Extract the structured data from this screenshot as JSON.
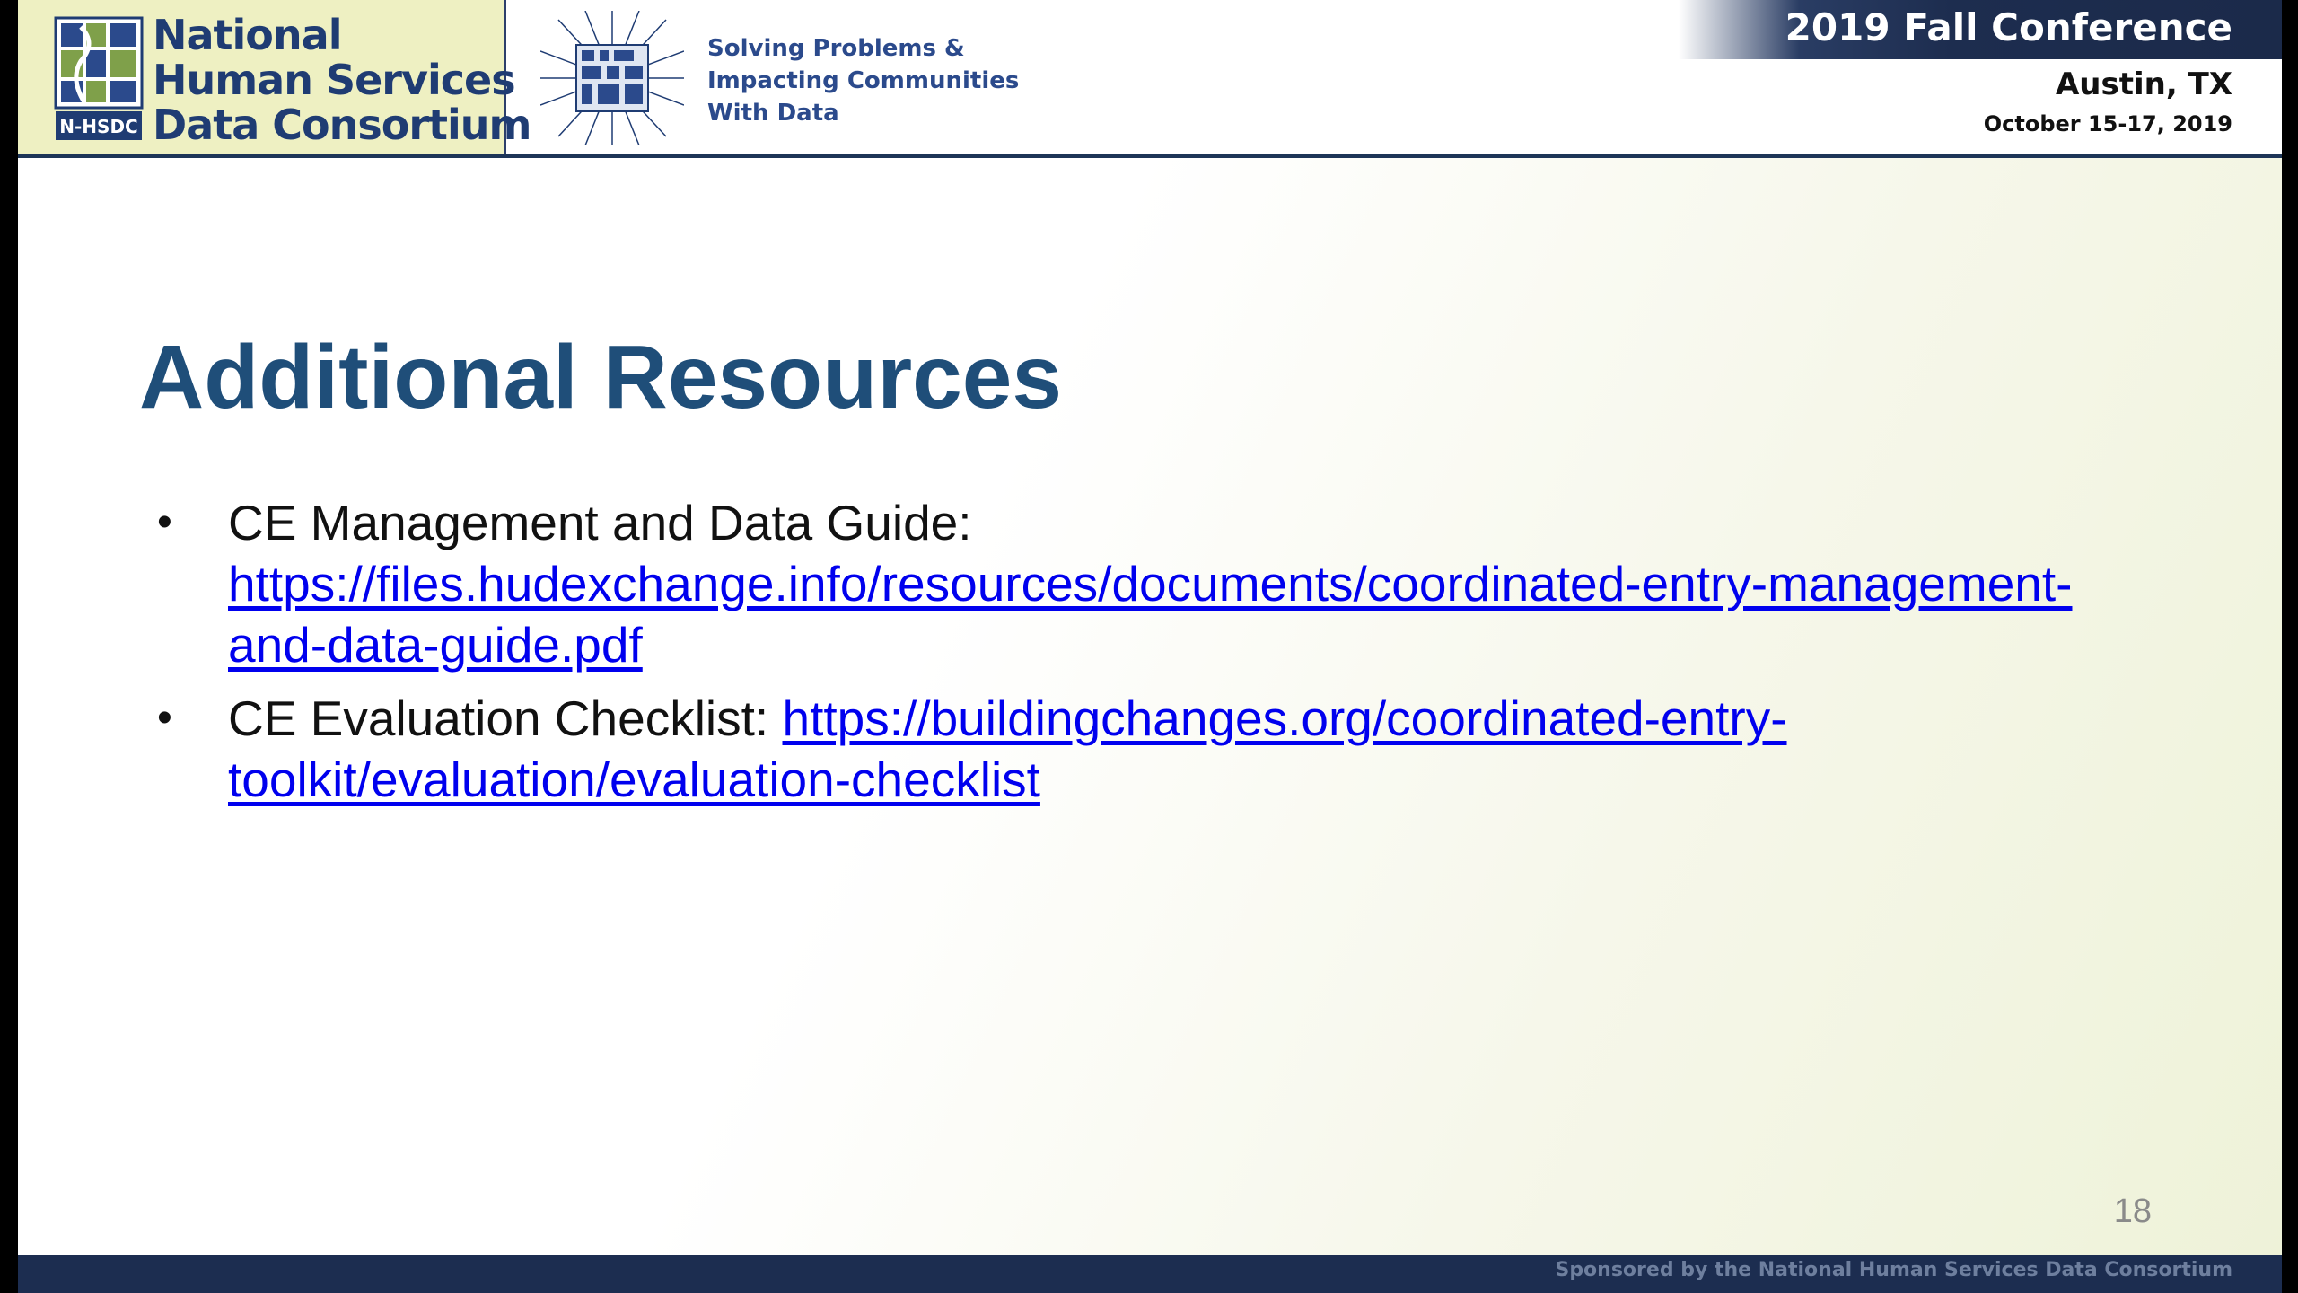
{
  "header": {
    "logo": {
      "lines": [
        "National",
        "Human Services",
        "Data Consortium"
      ],
      "mark_text": "N-HSDC"
    },
    "tagline": [
      "Solving Problems &",
      "Impacting Communities",
      "With Data"
    ],
    "conference": {
      "title": "2019 Fall Conference",
      "city": "Austin, TX",
      "dates": "October 15-17, 2019"
    }
  },
  "slide": {
    "title": "Additional Resources",
    "bullets": [
      {
        "label": "CE Management and Data Guide:",
        "link_line1": "https://files.hudexchange.info/resources/documents/coordinated-entry-management-",
        "link_line2": "and-data-guide.pdf"
      },
      {
        "label": "CE Evaluation Checklist: ",
        "link_line1": "https://buildingchanges.org/coordinated-entry-",
        "link_line2": "toolkit/evaluation/evaluation-checklist"
      }
    ],
    "bullet_glyph": "•",
    "page_number": "18"
  },
  "footer": {
    "text": "Sponsored by the National Human Services Data Consortium"
  },
  "colors": {
    "title": "#1f4e79",
    "link": "#0000ee",
    "navy": "#1c2d50",
    "logo_bg": "#eef0c2"
  }
}
